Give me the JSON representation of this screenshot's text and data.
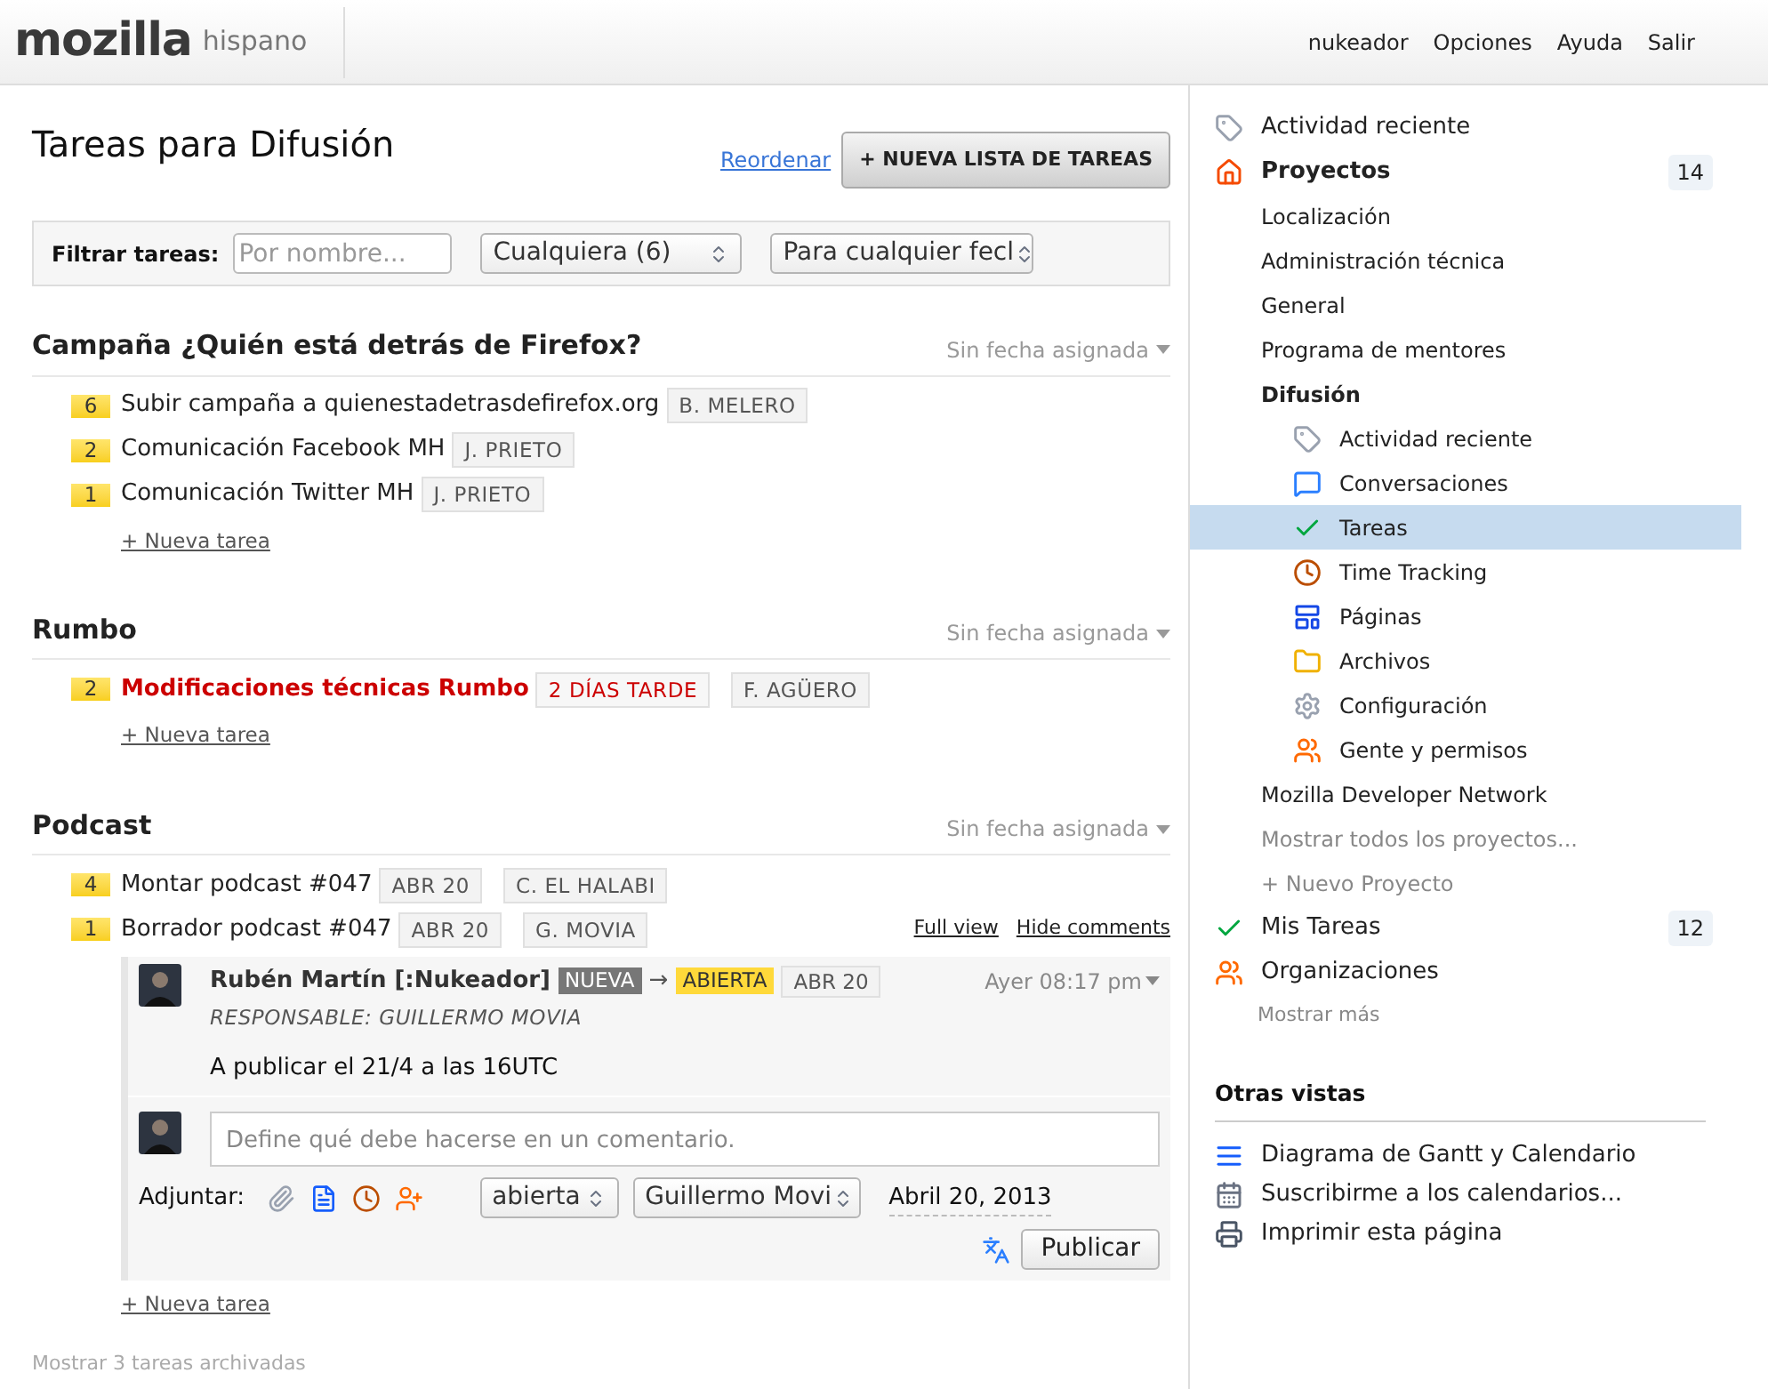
{
  "header": {
    "brand": "mozilla",
    "sub_brand": "hispano",
    "nav": [
      "nukeador",
      "Opciones",
      "Ayuda",
      "Salir"
    ]
  },
  "main": {
    "title": "Tareas para Difusión",
    "reorder_link": "Reordenar",
    "new_list_button": "+ NUEVA LISTA DE TAREAS",
    "filter": {
      "label": "Filtrar tareas:",
      "name_placeholder": "Por nombre...",
      "status_select": "Cualquiera (6)",
      "date_select": "Para cualquier fecl"
    },
    "lists": [
      {
        "title": "Campaña ¿Quién está detrás de Firefox?",
        "date_label": "Sin fecha asignada",
        "new_task": "+ Nueva tarea",
        "tasks": [
          {
            "priority": "6",
            "title": "Subir campaña a quienestadetrasdefirefox.org",
            "overdue": false,
            "tags": [
              {
                "text": "B. MELERO",
                "kind": "person"
              }
            ]
          },
          {
            "priority": "2",
            "title": "Comunicación Facebook MH",
            "overdue": false,
            "tags": [
              {
                "text": "J. PRIETO",
                "kind": "person"
              }
            ]
          },
          {
            "priority": "1",
            "title": "Comunicación Twitter MH",
            "overdue": false,
            "tags": [
              {
                "text": "J. PRIETO",
                "kind": "person"
              }
            ]
          }
        ]
      },
      {
        "title": "Rumbo",
        "date_label": "Sin fecha asignada",
        "new_task": "+ Nueva tarea",
        "tasks": [
          {
            "priority": "2",
            "title": "Modificaciones técnicas Rumbo",
            "overdue": true,
            "tags": [
              {
                "text": "2 DÍAS TARDE",
                "kind": "late"
              },
              {
                "text": "F. AGÜERO",
                "kind": "person"
              }
            ]
          }
        ]
      },
      {
        "title": "Podcast",
        "date_label": "Sin fecha asignada",
        "new_task": "+ Nueva tarea",
        "tasks": [
          {
            "priority": "4",
            "title": "Montar podcast #047",
            "overdue": false,
            "tags": [
              {
                "text": "ABR 20",
                "kind": "date"
              },
              {
                "text": "C. EL HALABI",
                "kind": "person"
              }
            ]
          },
          {
            "priority": "1",
            "title": "Borrador podcast #047",
            "overdue": false,
            "tags": [
              {
                "text": "ABR 20",
                "kind": "date"
              },
              {
                "text": "G. MOVIA",
                "kind": "person"
              }
            ],
            "links": [
              "Full view",
              "Hide comments"
            ],
            "comment": {
              "author": "Rubén Martín [:Nukeador]",
              "status_from": "NUEVA",
              "arrow": "→",
              "status_to": "ABIERTA",
              "date_tag": "ABR 20",
              "time": "Ayer 08:17 pm",
              "responsible": "RESPONSABLE:  GUILLERMO MOVIA",
              "body": "A publicar el 21/4 a las 16UTC"
            },
            "reply": {
              "placeholder": "Define qué debe hacerse en un comentario.",
              "attach_label": "Adjuntar:",
              "status_select": "abierta",
              "assignee_select": "Guillermo Movi",
              "date": "Abril 20, 2013",
              "submit": "Publicar"
            }
          }
        ]
      }
    ],
    "archived_link": "Mostrar 3 tareas archivadas"
  },
  "sidebar": {
    "nav": [
      {
        "label": "Actividad reciente",
        "kind": "tag"
      },
      {
        "label": "Proyectos",
        "kind": "house",
        "count": "14",
        "children": [
          {
            "label": "Localización"
          },
          {
            "label": "Administración técnica"
          },
          {
            "label": "General"
          },
          {
            "label": "Programa de mentores"
          },
          {
            "label": "Difusión",
            "children": [
              {
                "label": "Actividad reciente",
                "kind": "tag",
                "selected": false
              },
              {
                "label": "Conversaciones",
                "kind": "chat",
                "selected": false
              },
              {
                "label": "Tareas",
                "kind": "check",
                "selected": true
              },
              {
                "label": "Time Tracking",
                "kind": "clock",
                "selected": false
              },
              {
                "label": "Páginas",
                "kind": "page",
                "selected": false
              },
              {
                "label": "Archivos",
                "kind": "folder",
                "selected": false
              },
              {
                "label": "Configuración",
                "kind": "gear",
                "selected": false
              },
              {
                "label": "Gente y permisos",
                "kind": "people",
                "selected": false
              }
            ]
          },
          {
            "label": "Mozilla Developer Network"
          },
          {
            "label": "Mostrar todos los proyectos...",
            "kind": "muted"
          },
          {
            "label": "+ Nuevo Proyecto",
            "kind": "muted"
          }
        ]
      },
      {
        "label": "Mis Tareas",
        "kind": "check",
        "count": "12"
      },
      {
        "label": "Organizaciones",
        "kind": "people"
      }
    ],
    "more_link": "Mostrar más",
    "other_views": {
      "title": "Otras vistas",
      "items": [
        {
          "label": "Diagrama de Gantt y Calendario",
          "kind": "gantt"
        },
        {
          "label": "Suscribirme a los calendarios...",
          "kind": "calendar"
        },
        {
          "label": "Imprimir esta página",
          "kind": "printer"
        }
      ]
    }
  }
}
